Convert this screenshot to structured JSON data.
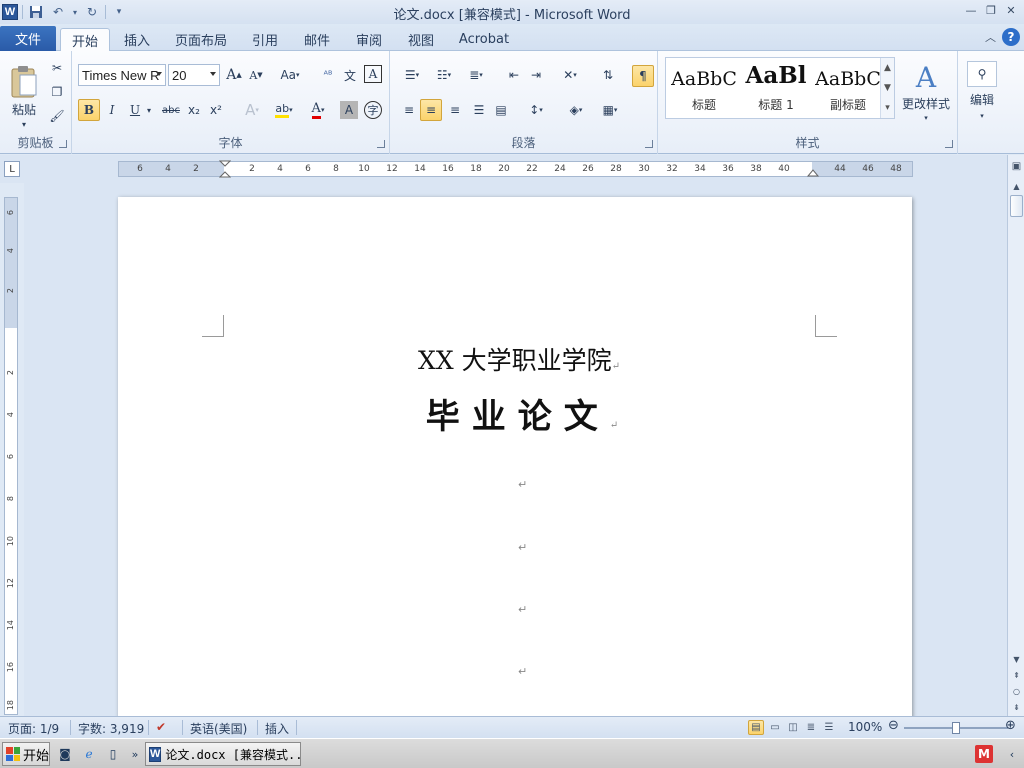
{
  "window": {
    "title": "论文.docx [兼容模式]  -  Microsoft Word",
    "app_icon": "word-icon"
  },
  "quick_access": [
    "save-icon",
    "undo-icon",
    "redo-icon",
    "customize-icon"
  ],
  "tabs": [
    {
      "label": "文件"
    },
    {
      "label": "开始"
    },
    {
      "label": "插入"
    },
    {
      "label": "页面布局"
    },
    {
      "label": "引用"
    },
    {
      "label": "邮件"
    },
    {
      "label": "审阅"
    },
    {
      "label": "视图"
    },
    {
      "label": "Acrobat"
    }
  ],
  "active_tab": "开始",
  "ribbon": {
    "clipboard": {
      "label": "剪贴板",
      "paste_label": "粘贴"
    },
    "font": {
      "label": "字体",
      "font_name": "Times New R",
      "font_size": "20",
      "grow_label": "A",
      "shrink_label": "A",
      "case_label": "Aa",
      "bold": "B",
      "italic": "I",
      "underline": "U",
      "strikethrough": "abc",
      "subscript": "x₂",
      "superscript": "x²"
    },
    "paragraph": {
      "label": "段落"
    },
    "styles": {
      "label": "样式",
      "items": [
        {
          "sample": "AaBbC",
          "name": "标题"
        },
        {
          "sample": "AaBl",
          "name": "标题 1"
        },
        {
          "sample": "AaBbC",
          "name": "副标题"
        }
      ],
      "change_label": "更改样式"
    },
    "editing": {
      "label": "编辑"
    }
  },
  "ruler": {
    "ticks": [
      "6",
      "4",
      "2",
      "2",
      "4",
      "6",
      "8",
      "10",
      "12",
      "14",
      "16",
      "18",
      "20",
      "22",
      "24",
      "26",
      "28",
      "30",
      "32",
      "34",
      "36",
      "38",
      "40",
      "44",
      "46",
      "48"
    ],
    "vticks": [
      "6",
      "4",
      "2",
      "2",
      "4",
      "6",
      "8",
      "10",
      "12",
      "14",
      "16",
      "18"
    ]
  },
  "document": {
    "line1": "XX 大学职业学院",
    "line2": "毕业论文",
    "para_mark": "↵"
  },
  "status": {
    "page": "页面: 1/9",
    "words": "字数: 3,919",
    "language": "英语(美国)",
    "mode": "插入",
    "zoom": "100%",
    "zoom_level": 0.5
  },
  "taskbar": {
    "start_label": "开始",
    "task_label": "论文.docx [兼容模式..."
  }
}
